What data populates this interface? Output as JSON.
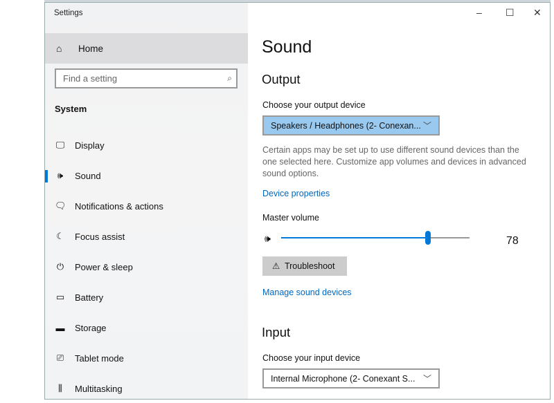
{
  "window": {
    "title": "Settings",
    "minimize": "–",
    "maximize": "☐",
    "close": "✕"
  },
  "sidebar": {
    "home": "Home",
    "search_placeholder": "Find a setting",
    "section": "System",
    "items": [
      {
        "label": "Display",
        "icon": "🖵"
      },
      {
        "label": "Sound",
        "icon": "🕪"
      },
      {
        "label": "Notifications & actions",
        "icon": "🗨"
      },
      {
        "label": "Focus assist",
        "icon": "☾"
      },
      {
        "label": "Power & sleep",
        "icon": "⏻"
      },
      {
        "label": "Battery",
        "icon": "▭"
      },
      {
        "label": "Storage",
        "icon": "▬"
      },
      {
        "label": "Tablet mode",
        "icon": "⎚"
      },
      {
        "label": "Multitasking",
        "icon": "⫼"
      }
    ]
  },
  "main": {
    "title": "Sound",
    "output": {
      "heading": "Output",
      "choose_label": "Choose your output device",
      "device": "Speakers / Headphones (2- Conexan...",
      "description": "Certain apps may be set up to use different sound devices than the one selected here. Customize app volumes and devices in advanced sound options.",
      "device_properties": "Device properties",
      "master_volume_label": "Master volume",
      "volume": 78,
      "volume_text": "78",
      "troubleshoot": "Troubleshoot",
      "manage": "Manage sound devices"
    },
    "input": {
      "heading": "Input",
      "choose_label": "Choose your input device",
      "device": "Internal Microphone (2- Conexant S..."
    }
  },
  "colors": {
    "accent": "#0078d7",
    "link": "#0067c0",
    "selected_dropdown": "#99c9ef"
  }
}
